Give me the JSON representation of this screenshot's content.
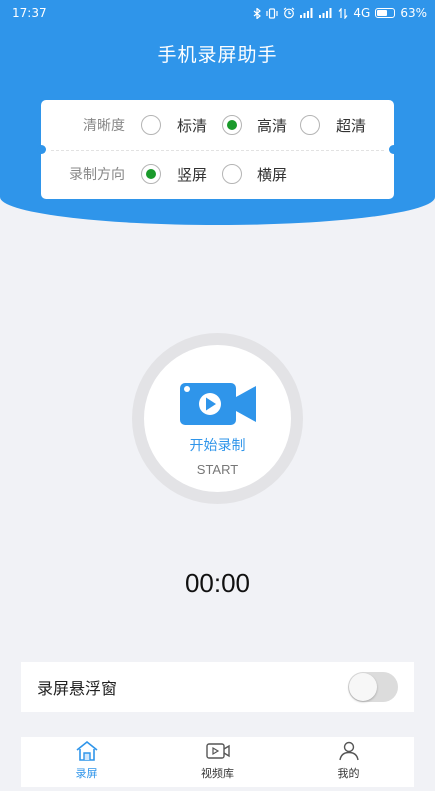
{
  "status_bar": {
    "time": "17:37",
    "network": "4G",
    "battery": "63%",
    "battery_level": 0.63
  },
  "app": {
    "title": "手机录屏助手"
  },
  "settings": {
    "quality": {
      "label": "清晰度",
      "options": [
        "标清",
        "高清",
        "超清"
      ],
      "selected": "高清"
    },
    "orientation": {
      "label": "录制方向",
      "options": [
        "竖屏",
        "横屏"
      ],
      "selected": "竖屏"
    }
  },
  "record": {
    "icon": "video-camera-icon",
    "label": "开始录制",
    "sub_label": "START"
  },
  "timer": "00:00",
  "floating_window": {
    "label": "录屏悬浮窗",
    "enabled": false
  },
  "tabs": [
    {
      "label": "录屏",
      "icon": "home-icon",
      "active": true
    },
    {
      "label": "视频库",
      "icon": "video-library-icon",
      "active": false
    },
    {
      "label": "我的",
      "icon": "person-icon",
      "active": false
    }
  ],
  "colors": {
    "primary": "#2f95ea",
    "radio_selected": "#1a9a2b",
    "background": "#f1f2f6"
  }
}
